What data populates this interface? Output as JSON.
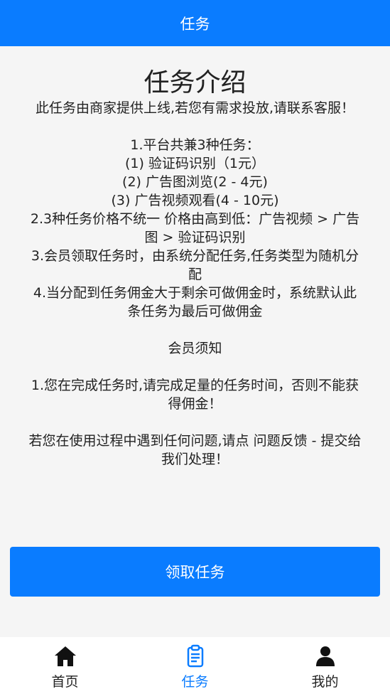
{
  "header": {
    "title": "任务"
  },
  "intro": {
    "title": "任务介绍",
    "subtitle": "此任务由商家提供上线,若您有需求投放,请联系客服！",
    "lines": [
      "1.平台共兼3种任务：",
      "(1) 验证码识别（1元）",
      "(2) 广告图浏览(2 - 4元)",
      "(3) 广告视频观看(4 - 10元)",
      "2.3种任务价格不统一 价格由高到低：广告视频 > 广告",
      "图 > 验证码识别",
      "3.会员领取任务时，由系统分配任务,任务类型为随机分",
      "配",
      "4.当分配到任务佣金大于剩余可做佣金时，系统默认此",
      "条任务为最后可做佣金"
    ],
    "notice_title": "会员须知",
    "notice_lines": [
      "1.您在完成任务时,请完成足量的任务时间，否则不能获",
      "得佣金！"
    ],
    "help_lines": [
      "若您在使用过程中遇到任何问题,请点 问题反馈 - 提交给",
      "我们处理！"
    ]
  },
  "claim_button": {
    "label": "领取任务"
  },
  "tabbar": {
    "items": [
      {
        "label": "首页",
        "icon": "home-icon",
        "active": false
      },
      {
        "label": "任务",
        "icon": "clipboard-icon",
        "active": true
      },
      {
        "label": "我的",
        "icon": "user-icon",
        "active": false
      }
    ]
  },
  "colors": {
    "primary": "#0a7cff",
    "background": "#f5f5f5"
  }
}
